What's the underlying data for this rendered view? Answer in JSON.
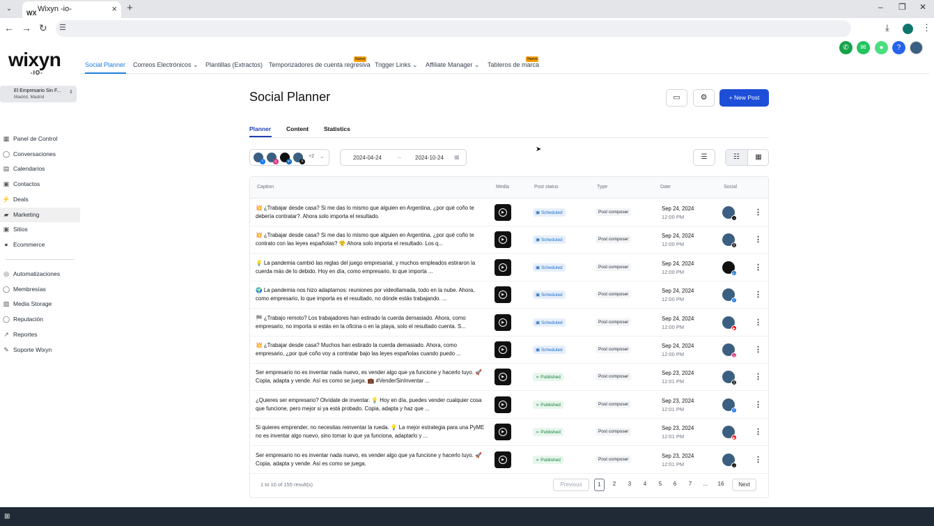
{
  "browser": {
    "tab_title": "Wixyn -io-",
    "tab_favicon": "WX",
    "new_tab": "+",
    "window_controls": [
      "–",
      "❐",
      "✕"
    ]
  },
  "app": {
    "logo": "wixyn",
    "logo_sub": "-IO-",
    "topnav": [
      {
        "label": "Social Planner",
        "active": true
      },
      {
        "label": "Correos Electrónicos ⌄"
      },
      {
        "label": "Plantillas (Extractos)"
      },
      {
        "label": "Temporizadores de cuenta regresiva",
        "badge": "Nuevo"
      },
      {
        "label": "Trigger Links ⌄"
      },
      {
        "label": "Affiliate Manager ⌄"
      },
      {
        "label": "Tableros de marca",
        "badge": "Nuevo"
      }
    ],
    "header_icons": [
      {
        "name": "phone-icon",
        "color": "#16a34a",
        "glyph": "✆"
      },
      {
        "name": "megaphone-icon",
        "color": "#22c55e",
        "glyph": "📣"
      },
      {
        "name": "bell-icon",
        "color": "#4ade80",
        "glyph": "🔔"
      },
      {
        "name": "help-icon",
        "color": "#2563eb",
        "glyph": "?"
      }
    ]
  },
  "sidebar": {
    "account_name": "El Empresario Sin F...",
    "account_location": "Madrid, Madrid",
    "account_chevron": "⇕",
    "items": [
      {
        "label": "Panel de Control",
        "icon": "▦"
      },
      {
        "label": "Conversaciones",
        "icon": "◯"
      },
      {
        "label": "Calendarios",
        "icon": "▤"
      },
      {
        "label": "Contactos",
        "icon": "▣"
      },
      {
        "label": "Deals",
        "icon": "⚡"
      },
      {
        "label": "Marketing",
        "icon": "▰",
        "active": true
      },
      {
        "label": "Sitios",
        "icon": "▣"
      },
      {
        "label": "Ecommerce",
        "icon": "●"
      },
      {
        "label": "Automatizaciones",
        "icon": "◎"
      },
      {
        "label": "Membresías",
        "icon": "◯"
      },
      {
        "label": "Media Storage",
        "icon": "▨"
      },
      {
        "label": "Reputación",
        "icon": "◯"
      },
      {
        "label": "Reportes",
        "icon": "↗"
      },
      {
        "label": "Soporte Wixyn",
        "icon": "✎"
      }
    ]
  },
  "main": {
    "title": "Social Planner",
    "new_post": "+ New Post",
    "tabs": [
      {
        "label": "Planner",
        "active": true
      },
      {
        "label": "Content"
      },
      {
        "label": "Statistics"
      }
    ],
    "avatars_more": "+2",
    "date_from": "2024-04-24",
    "date_to": "2024-10-24",
    "date_arrow": "→",
    "columns": [
      "Caption",
      "Media",
      "Post status",
      "Type",
      "Date",
      "Social"
    ],
    "rows": [
      {
        "caption": "💥 ¿Trabajar desde casa? Si me das lo mismo que alguien en Argentina, ¿por qué coño te debería contratar?. Ahora solo importa el resultado.",
        "status": "Scheduled",
        "type": "Post composer",
        "date": "Sep 24, 2024",
        "time": "12:00 PM",
        "network": "tiktok",
        "badge_color": "#111",
        "badge": "♪"
      },
      {
        "caption": "💥 ¿Trabajar desde casa? Si me das lo mismo que alguien en Argentina, ¿por qué coño te contrato con las leyes españolas? 😤 Ahora solo importa el resultado. Los q...",
        "status": "Scheduled",
        "type": "Post composer",
        "date": "Sep 24, 2024",
        "time": "12:00 PM",
        "network": "x",
        "badge_color": "#111",
        "badge": "X"
      },
      {
        "caption": "💡 La pandemia cambió las reglas del juego empresarial, y muchos empleados estiraron la cuerda más de lo debido. Hoy en día, como empresario, lo que importa ...",
        "status": "Scheduled",
        "type": "Post composer",
        "date": "Sep 24, 2024",
        "time": "12:00 PM",
        "network": "linkedin",
        "badge_color": "#0a66c2",
        "badge": "in",
        "dark": true
      },
      {
        "caption": "🌍 La pandemia nos hizo adaptarnos: reuniones por videollamada, todo en la nube. Ahora, como empresario, lo que importa es el resultado, no dónde estás trabajando. ...",
        "status": "Scheduled",
        "type": "Post composer",
        "date": "Sep 24, 2024",
        "time": "12:00 PM",
        "network": "facebook",
        "badge_color": "#1877f2",
        "badge": "f"
      },
      {
        "caption": "🏁 ¿Trabajo remoto? Los trabajadores han estirado la cuerda demasiado. Ahora, como empresario, no importa si estás en la oficina o en la playa, solo el resultado cuenta. S...",
        "status": "Scheduled",
        "type": "Post composer",
        "date": "Sep 24, 2024",
        "time": "12:00 PM",
        "network": "youtube",
        "badge_color": "#ff0000",
        "badge": "▶"
      },
      {
        "caption": "💥 ¿Trabajar desde casa? Muchos han estirado la cuerda demasiado. Ahora, como empresario, ¿por qué coño voy a contratar bajo las leyes españolas cuando puedo ...",
        "status": "Scheduled",
        "type": "Post composer",
        "date": "Sep 24, 2024",
        "time": "12:00 PM",
        "network": "instagram",
        "badge_color": "#d62976",
        "badge": "◎"
      },
      {
        "caption": "Ser empresario no es inventar nada nuevo, es vender algo que ya funcione y hacerlo tuyo. 🚀 Copia, adapta y vende. Así es como se juega. 💼 #VenderSinInventar ...",
        "status": "Published",
        "type": "Post composer",
        "date": "Sep 23, 2024",
        "time": "12:01 PM",
        "network": "x",
        "badge_color": "#111",
        "badge": "X"
      },
      {
        "caption": "¿Quieres ser empresario? Olvídate de inventar. 💡 Hoy en día, puedes vender cualquier cosa que funcione, pero mejor si ya está probado. Copia, adapta y haz que ...",
        "status": "Published",
        "type": "Post composer",
        "date": "Sep 23, 2024",
        "time": "12:01 PM",
        "network": "facebook",
        "badge_color": "#1877f2",
        "badge": "f"
      },
      {
        "caption": "Si quieres emprender, no necesitas reinventar la rueda. 💡 La mejor estrategia para una PyME no es inventar algo nuevo, sino tomar lo que ya funciona, adaptarlo y ...",
        "status": "Published",
        "type": "Post composer",
        "date": "Sep 23, 2024",
        "time": "12:01 PM",
        "network": "youtube",
        "badge_color": "#ff0000",
        "badge": "▶"
      },
      {
        "caption": "Ser empresario no es inventar nada nuevo, es vender algo que ya funcione y hacerlo tuyo. 🚀 Copia, adapta y vende. Así es como se juega.",
        "status": "Published",
        "type": "Post composer",
        "date": "Sep 23, 2024",
        "time": "12:01 PM",
        "network": "tiktok",
        "badge_color": "#111",
        "badge": "♪"
      }
    ],
    "results": "1 to 10 of 155 result(s)",
    "pagination": {
      "previous": "Previous",
      "pages": [
        "1",
        "2",
        "3",
        "4",
        "5",
        "6",
        "7",
        "...",
        "16"
      ],
      "next": "Next",
      "current": "1"
    }
  },
  "colors": {
    "accent": "#1d7fd8",
    "primary": "#1d4ed8",
    "scheduled": "#1d6ec9",
    "published": "#15803d"
  }
}
